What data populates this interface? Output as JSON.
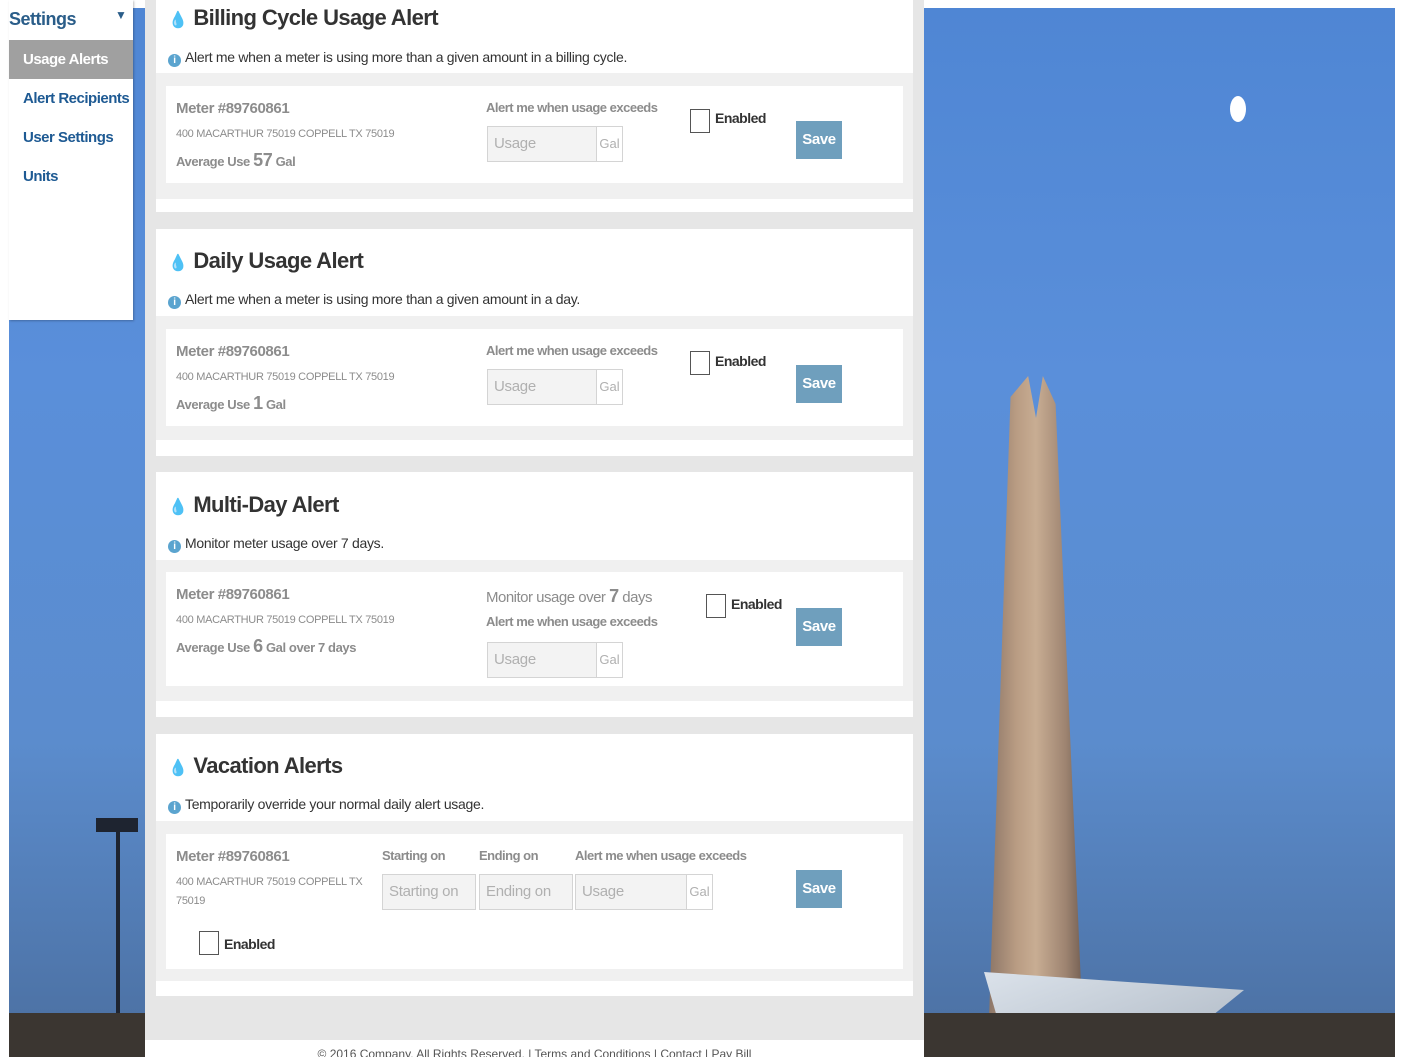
{
  "sidebar": {
    "title": "Settings",
    "items": [
      "Usage Alerts",
      "Alert Recipients",
      "User Settings",
      "Units"
    ]
  },
  "alerts": {
    "billing": {
      "title": "Billing Cycle Usage Alert",
      "desc": "Alert me when a meter is using more than a given amount in a billing cycle.",
      "meter": "Meter #89760861",
      "address": "400 MACARTHUR 75019 COPPELL TX 75019",
      "avg_prefix": "Average Use",
      "avg_value": "57",
      "avg_unit": "Gal",
      "label": "Alert me when usage exceeds",
      "placeholder": "Usage",
      "unit": "Gal",
      "enabled_label": "Enabled",
      "enabled": false,
      "save": "Save"
    },
    "daily": {
      "title": "Daily Usage Alert",
      "desc": "Alert me when a meter is using more than a given amount in a day.",
      "meter": "Meter #89760861",
      "address": "400 MACARTHUR 75019 COPPELL TX 75019",
      "avg_prefix": "Average Use",
      "avg_value": "1",
      "avg_unit": "Gal",
      "label": "Alert me when usage exceeds",
      "placeholder": "Usage",
      "unit": "Gal",
      "enabled_label": "Enabled",
      "enabled": false,
      "save": "Save"
    },
    "multiday": {
      "title": "Multi-Day Alert",
      "desc": "Monitor meter usage over 7 days.",
      "meter": "Meter #89760861",
      "address": "400 MACARTHUR 75019 COPPELL TX 75019",
      "avg_prefix": "Average Use",
      "avg_value": "6",
      "avg_unit": "Gal over 7 days",
      "monitor_prefix": "Monitor usage over",
      "monitor_days": "7",
      "monitor_suffix": "days",
      "label": "Alert me when usage exceeds",
      "placeholder": "Usage",
      "unit": "Gal",
      "enabled_label": "Enabled",
      "enabled": false,
      "save": "Save"
    },
    "vacation": {
      "title": "Vacation Alerts",
      "desc": "Temporarily override your normal daily alert usage.",
      "meter": "Meter #89760861",
      "address_line1": "400 MACARTHUR 75019 COPPELL TX",
      "address_line2": "75019",
      "start_label": "Starting on",
      "start_placeholder": "Starting on",
      "end_label": "Ending on",
      "end_placeholder": "Ending on",
      "label": "Alert me when usage exceeds",
      "placeholder": "Usage",
      "unit": "Gal",
      "enabled_label": "Enabled",
      "enabled": false,
      "save": "Save"
    }
  },
  "footer": {
    "text": "© 2016 Company. All Rights Reserved. | Terms and Conditions | Contact | Pay Bill"
  },
  "colors": {
    "accent": "#5ba4cf",
    "save_button": "#6f9fbd",
    "nav_link": "#1e5a93",
    "nav_active_bg": "#a0a0a0"
  }
}
